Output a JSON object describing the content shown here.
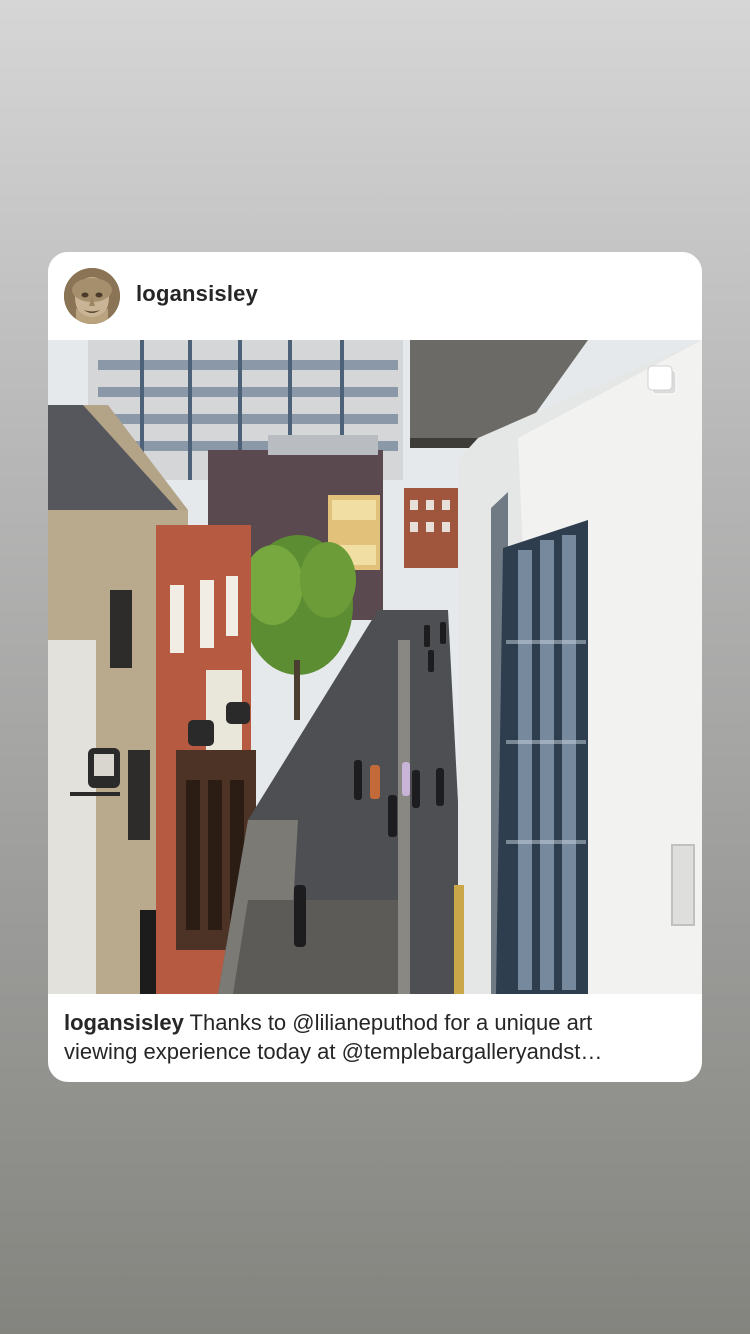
{
  "post": {
    "username": "logansisley",
    "caption_username": "logansisley",
    "caption_line1": " Thanks to @lilianeputhod for a unique art",
    "caption_line2": "viewing experience today at @templebargalleryandst…",
    "photo_icon": "multiple-images-icon",
    "avatar_icon": "profile-avatar-icon",
    "photo_subject": "street-photo"
  },
  "colors": {
    "card_background": "#ffffff",
    "text": "#262626",
    "page_gradient_top": "#d6d6d6",
    "page_gradient_bottom": "#84847f"
  }
}
